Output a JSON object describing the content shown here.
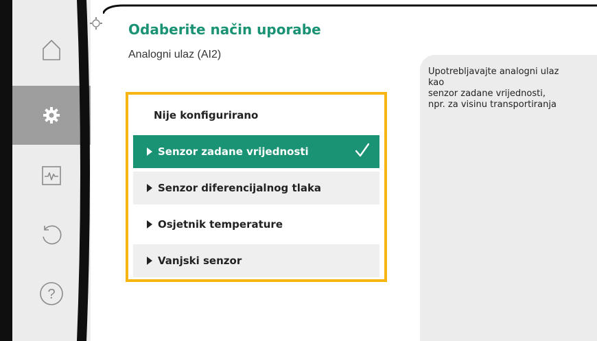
{
  "header": {
    "title": "Odaberite način uporabe",
    "subtitle": "Analogni ulaz (AI2)"
  },
  "sidebar": {
    "items": [
      {
        "icon": "home-icon"
      },
      {
        "icon": "gear-icon",
        "active": true
      },
      {
        "icon": "diagnostics-icon"
      },
      {
        "icon": "undo-icon"
      },
      {
        "icon": "help-icon"
      }
    ]
  },
  "options": [
    {
      "label": "Nije konfigurirano"
    },
    {
      "label": "Senzor zadane vrijednosti",
      "selected": true
    },
    {
      "label": "Senzor diferencijalnog tlaka"
    },
    {
      "label": "Osjetnik temperature"
    },
    {
      "label": "Vanjski senzor"
    }
  ],
  "info": {
    "lines": [
      "Upotrebljavajte analogni ulaz",
      "kao",
      "senzor zadane vrijednosti,",
      "npr. za visinu transportiranja"
    ]
  },
  "colors": {
    "accent": "#1a9274",
    "highlight_border": "#f7b512",
    "sidebar_bg": "#ececec",
    "sidebar_active": "#9e9e9e"
  }
}
